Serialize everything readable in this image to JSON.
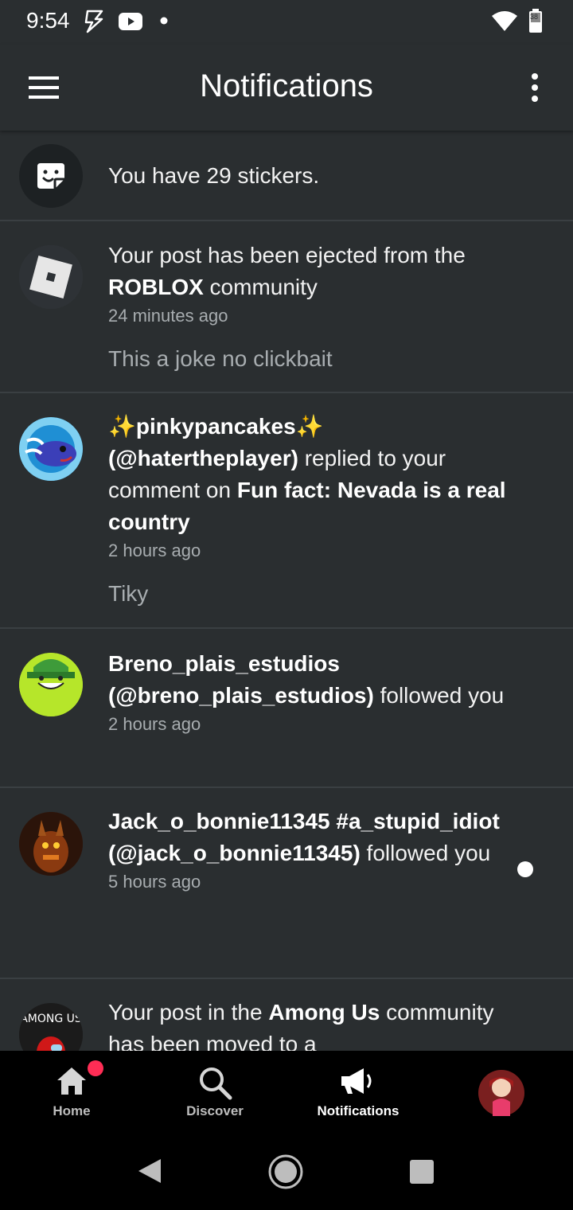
{
  "status_bar": {
    "time": "9:54",
    "battery_level": "38"
  },
  "app_bar": {
    "title": "Notifications"
  },
  "notifications": [
    {
      "text": "You have 29 stickers."
    },
    {
      "text_parts": [
        "Your post has been ejected from the ",
        "ROBLOX",
        " community"
      ],
      "time": "24 minutes ago",
      "snippet": "This a joke no clickbait"
    },
    {
      "sparkle": "✨",
      "username": "pinkypancakes",
      "handle": "(@hatertheplayer)",
      "action": " replied to your comment on ",
      "post_title": "Fun fact: Nevada is a real country",
      "time": "2 hours ago",
      "snippet": "Tiky"
    },
    {
      "username": "Breno_plais_estudios",
      "handle": "(@breno_plais_estudios)",
      "action": " followed you",
      "time": "2 hours ago"
    },
    {
      "username": "Jack_o_bonnie11345 #a_stupid_idiot",
      "handle": "(@jack_o_bonnie11345)",
      "action": " followed you",
      "time": "5 hours ago",
      "unread": true
    },
    {
      "text_parts": [
        "Your post in the ",
        "Among Us",
        " community has been moved to a"
      ],
      "avatar_label": "AMONG US"
    }
  ],
  "bottom_nav": {
    "home": "Home",
    "discover": "Discover",
    "notifications": "Notifications"
  },
  "colors": {
    "background": "#2a2e30",
    "divider": "#3a3f42",
    "secondary_text": "#a8adb0",
    "badge": "#ff2d55"
  }
}
